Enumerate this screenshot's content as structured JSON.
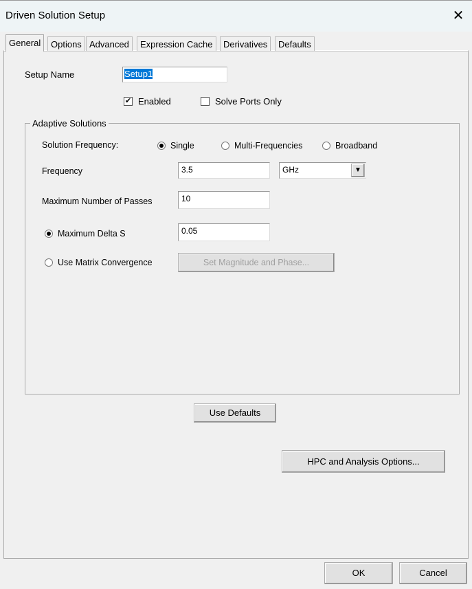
{
  "window": {
    "title": "Driven Solution Setup",
    "close_icon": "close-icon"
  },
  "tabs": [
    {
      "label": "General",
      "active": true
    },
    {
      "label": "Options"
    },
    {
      "label": "Advanced"
    },
    {
      "label": "Expression Cache"
    },
    {
      "label": "Derivatives"
    },
    {
      "label": "Defaults"
    }
  ],
  "setup": {
    "name_label": "Setup Name",
    "name_value": "Setup1",
    "enabled_label": "Enabled",
    "enabled": true,
    "solve_ports_label": "Solve Ports Only",
    "solve_ports": false
  },
  "adaptive": {
    "title": "Adaptive Solutions",
    "solution_frequency_label": "Solution Frequency:",
    "freq_options": [
      {
        "label": "Single",
        "selected": true
      },
      {
        "label": "Multi-Frequencies",
        "selected": false
      },
      {
        "label": "Broadband",
        "selected": false
      }
    ],
    "frequency_label": "Frequency",
    "frequency_value": "3.5",
    "frequency_unit": "GHz",
    "max_passes_label": "Maximum Number of Passes",
    "max_passes_value": "10",
    "max_delta_label": "Maximum Delta S",
    "max_delta_value": "0.05",
    "max_delta_selected": true,
    "matrix_label": "Use Matrix Convergence",
    "matrix_selected": false,
    "set_mag_phase_label": "Set Magnitude and Phase..."
  },
  "buttons": {
    "use_defaults": "Use Defaults",
    "hpc": "HPC and Analysis Options...",
    "ok": "OK",
    "cancel": "Cancel"
  }
}
